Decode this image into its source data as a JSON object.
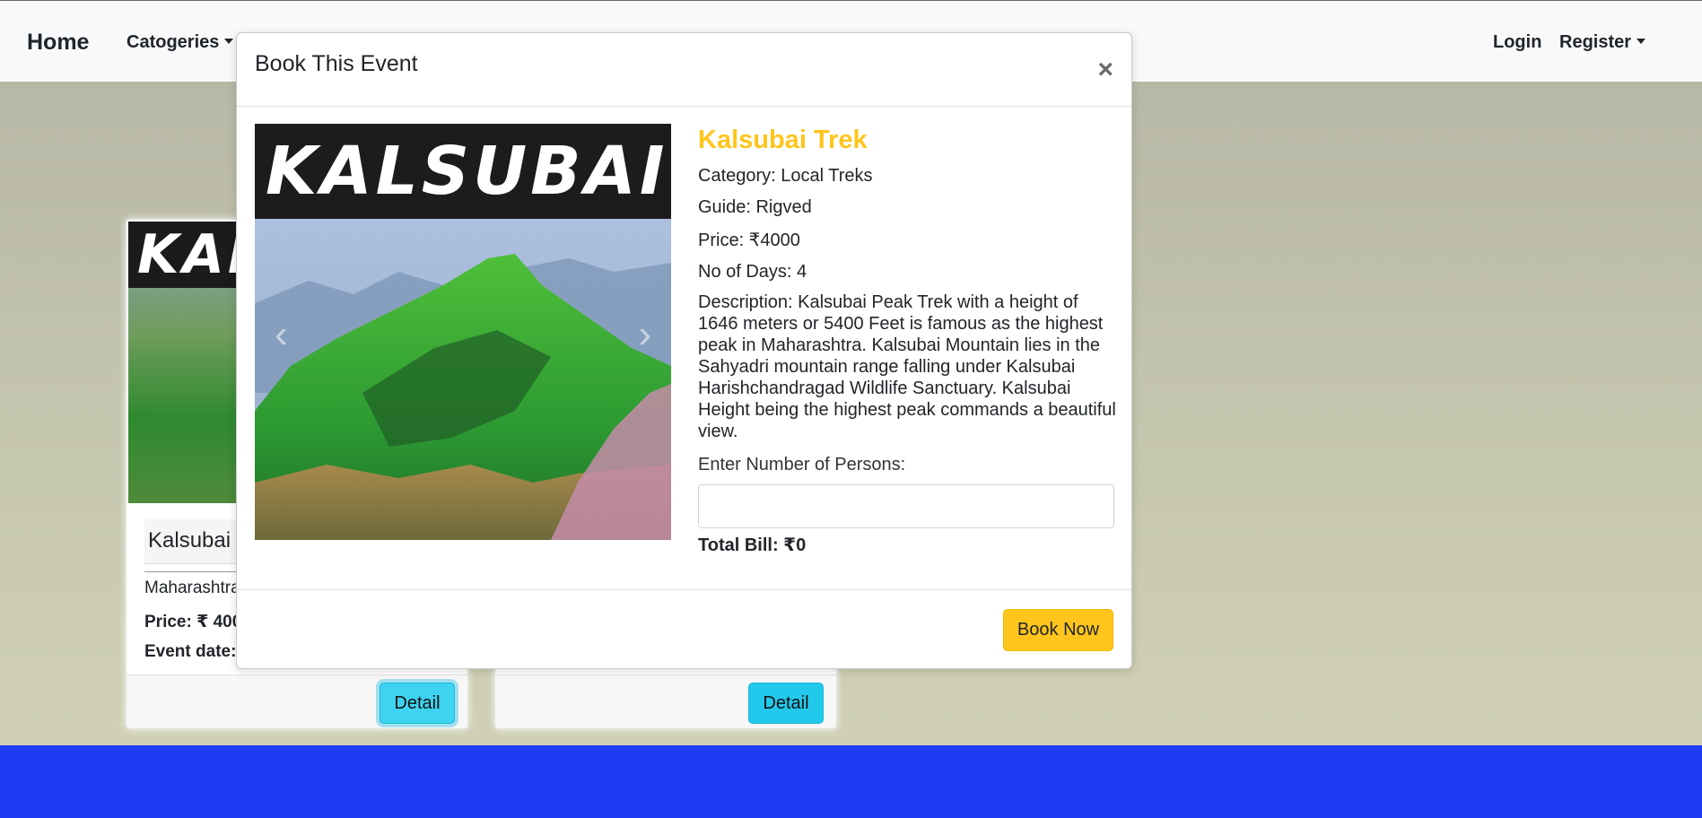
{
  "navbar": {
    "brand": "Home",
    "categories_label": "Catogeries",
    "login_label": "Login",
    "register_label": "Register"
  },
  "cards": [
    {
      "banner": "KAL",
      "title": "Kalsubai",
      "location": "Maharashtra",
      "price": "Price: ₹ 400",
      "date": "Event date:",
      "detail_label": "Detail"
    },
    {
      "detail_label": "Detail"
    }
  ],
  "modal": {
    "title": "Book This Event",
    "close_symbol": "×",
    "image_banner": "KALSUBAI",
    "prev_symbol": "‹",
    "next_symbol": "›",
    "event_name": "Kalsubai Trek",
    "category": "Category: Local Treks",
    "guide": "Guide: Rigved",
    "price": "Price: ₹4000",
    "days": "No of Days: 4",
    "description": "Description: Kalsubai Peak Trek with a height of 1646 meters or 5400 Feet is famous as the highest peak in Maharashtra. Kalsubai Mountain lies in the Sahyadri mountain range falling under Kalsubai Harishchandragad Wildlife Sanctuary. Kalsubai Height being the highest peak commands a beautiful view.",
    "persons_label": "Enter Number of Persons:",
    "persons_value": "",
    "total_bill": "Total Bill: ₹0",
    "book_label": "Book Now"
  },
  "colors": {
    "accent_yellow": "#ffc51c",
    "info_blue": "#22c9ec",
    "footer_blue": "#1e3cf5"
  }
}
